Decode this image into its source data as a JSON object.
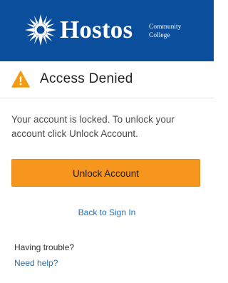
{
  "header": {
    "brand_name": "Hostos",
    "brand_tagline_line1": "Community",
    "brand_tagline_line2": "College",
    "logo_icon": "sun-icon",
    "background_color": "#0b4f9c"
  },
  "notice": {
    "icon": "warning-icon",
    "title": "Access Denied",
    "message": "Your account is locked. To unlock your account click Unlock Account."
  },
  "actions": {
    "unlock_label": "Unlock Account",
    "back_label": "Back to Sign In"
  },
  "help": {
    "prompt": "Having trouble?",
    "link_label": "Need help?"
  },
  "colors": {
    "accent": "#f7961d",
    "link": "#1f6fb6",
    "warning": "#f39c12"
  }
}
